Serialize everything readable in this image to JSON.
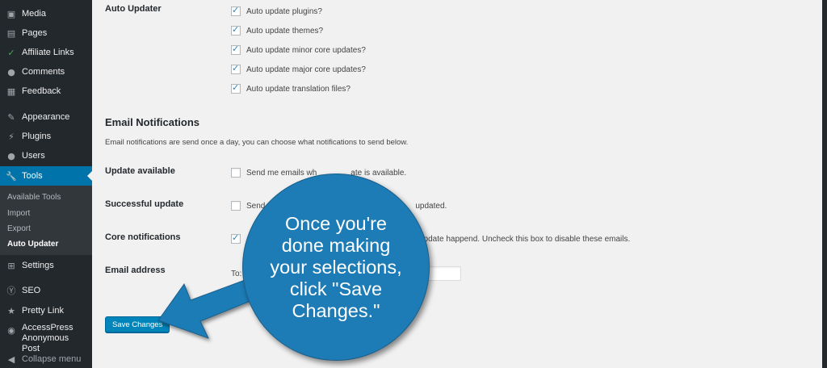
{
  "sidebar": {
    "items": [
      {
        "label": "Media",
        "icon": "media-icon"
      },
      {
        "label": "Pages",
        "icon": "pages-icon"
      },
      {
        "label": "Affiliate Links",
        "icon": "affiliate-links-icon"
      },
      {
        "label": "Comments",
        "icon": "comments-icon"
      },
      {
        "label": "Feedback",
        "icon": "feedback-icon"
      },
      {
        "label": "Appearance",
        "icon": "appearance-icon"
      },
      {
        "label": "Plugins",
        "icon": "plugins-icon"
      },
      {
        "label": "Users",
        "icon": "users-icon"
      },
      {
        "label": "Tools",
        "icon": "tools-icon"
      },
      {
        "label": "Settings",
        "icon": "settings-icon"
      },
      {
        "label": "SEO",
        "icon": "seo-icon"
      },
      {
        "label": "Pretty Link",
        "icon": "pretty-link-icon"
      },
      {
        "label": "AccessPress Anonymous Post",
        "icon": "accesspress-icon"
      },
      {
        "label": "Collapse menu",
        "icon": "collapse-icon"
      }
    ],
    "submenu": [
      "Available Tools",
      "Import",
      "Export",
      "Auto Updater"
    ],
    "active_color": "#0073aa"
  },
  "auto_updater": {
    "label": "Auto Updater",
    "options": [
      "Auto update plugins?",
      "Auto update themes?",
      "Auto update minor core updates?",
      "Auto update major core updates?",
      "Auto update translation files?"
    ]
  },
  "email_notifications": {
    "title": "Email Notifications",
    "description": "Email notifications are send once a day, you can choose what notifications to send below.",
    "rows": [
      {
        "label": "Update available",
        "text": "Send me emails wh",
        "text_tail": "ate is available.",
        "checked": false
      },
      {
        "label": "Successful update",
        "text": "Send",
        "text_tail": "updated.",
        "checked": false
      },
      {
        "label": "Core notifications",
        "text": "",
        "text_tail": "update happend. Uncheck this box to disable these emails.",
        "checked": true
      }
    ],
    "email_label": "Email address",
    "email_to": "To:",
    "email_value": ""
  },
  "save_label": "Save Changes",
  "callout": {
    "text": "Once you're\ndone making\nyour selections,\nclick \"Save\nChanges.\"",
    "color": "#1d7bb5"
  }
}
